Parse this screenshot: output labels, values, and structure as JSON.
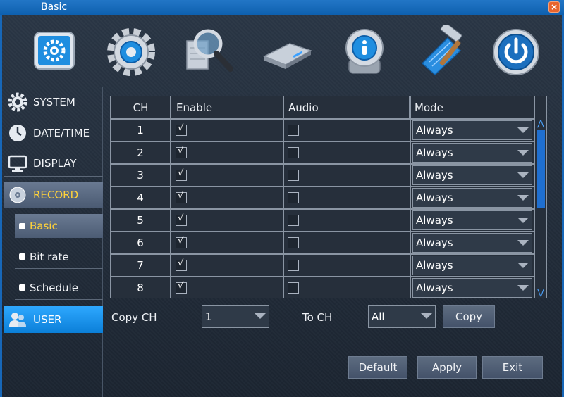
{
  "window": {
    "title": "Basic",
    "close_icon": "close-icon"
  },
  "toolbar": {
    "icons": [
      "system-settings-icon",
      "gear-icon",
      "search-icon",
      "hard-disk-icon",
      "info-icon",
      "tools-icon",
      "power-icon"
    ]
  },
  "sidebar": {
    "items": [
      {
        "label": "SYSTEM",
        "icon": "gear-icon"
      },
      {
        "label": "DATE/TIME",
        "icon": "clock-icon"
      },
      {
        "label": "DISPLAY",
        "icon": "monitor-icon"
      },
      {
        "label": "RECORD",
        "icon": "record-disc-icon"
      },
      {
        "label": "USER",
        "icon": "users-icon"
      }
    ],
    "record_subitems": [
      {
        "label": "Basic"
      },
      {
        "label": "Bit rate"
      },
      {
        "label": "Schedule"
      }
    ]
  },
  "table": {
    "headers": {
      "ch": "CH",
      "enable": "Enable",
      "audio": "Audio",
      "mode": "Mode"
    },
    "rows": [
      {
        "ch": "1",
        "enable": true,
        "audio": false,
        "mode": "Always"
      },
      {
        "ch": "2",
        "enable": true,
        "audio": false,
        "mode": "Always"
      },
      {
        "ch": "3",
        "enable": true,
        "audio": false,
        "mode": "Always"
      },
      {
        "ch": "4",
        "enable": true,
        "audio": false,
        "mode": "Always"
      },
      {
        "ch": "5",
        "enable": true,
        "audio": false,
        "mode": "Always"
      },
      {
        "ch": "6",
        "enable": true,
        "audio": false,
        "mode": "Always"
      },
      {
        "ch": "7",
        "enable": true,
        "audio": false,
        "mode": "Always"
      },
      {
        "ch": "8",
        "enable": true,
        "audio": false,
        "mode": "Always"
      }
    ]
  },
  "copy_row": {
    "copy_ch_label": "Copy CH",
    "copy_ch_value": "1",
    "to_ch_label": "To CH",
    "to_ch_value": "All",
    "copy_button": "Copy"
  },
  "footer": {
    "default_button": "Default",
    "apply_button": "Apply",
    "exit_button": "Exit"
  },
  "colors": {
    "accent_blue": "#1767b8",
    "active_text": "#ffd23a",
    "user_highlight": "#2ea8ff"
  }
}
